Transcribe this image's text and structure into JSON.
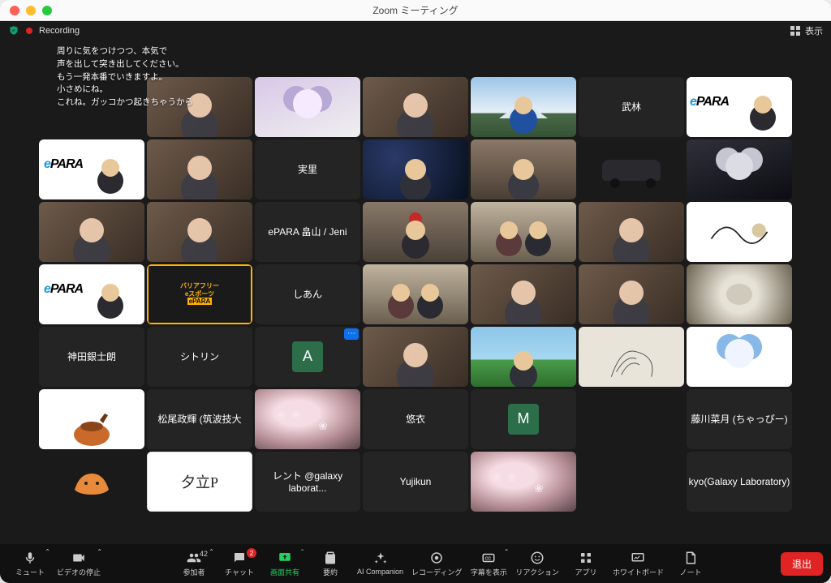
{
  "window": {
    "title": "Zoom ミーティング"
  },
  "topbar": {
    "recording_label": "Recording",
    "view_label": "表示"
  },
  "captions": [
    "周りに気をつけつつ、本気で",
    "声を出して突き出してください。",
    "もう一発本番でいきますよ。",
    "小さめにね。",
    "これね。ガッコかつ起きちゃうから"
  ],
  "tiles": {
    "r1": [
      "",
      "video",
      "anime",
      "video",
      "fuji",
      {
        "name": "武林"
      },
      "epara-glasses"
    ],
    "r2": [
      "epara-person",
      "speaker",
      {
        "name": "実里"
      },
      "space",
      "room",
      "car",
      "dark-anime"
    ],
    "r3": [
      "video",
      "video",
      {
        "name": "ePARA 畠山 / Jeni"
      },
      "santa",
      "two",
      "video",
      "white-draw"
    ],
    "r4": [
      "epara-person",
      "poster",
      {
        "name": "しあん"
      },
      "two",
      "video",
      "video",
      "bird"
    ],
    "r5": [
      {
        "name": "神田銀士朗"
      },
      {
        "name": "シトリン"
      },
      {
        "initial": "A",
        "hover": true
      },
      "video",
      "field",
      "sketch",
      "chibi"
    ],
    "r6": [
      "pot",
      {
        "name": "松尾政輝 (筑波技大"
      },
      "sakura",
      {
        "name": "悠衣"
      },
      {
        "initial": "M"
      },
      "",
      {
        "name": "藤川菜月 (ちゃっぴー)"
      }
    ],
    "r7": [
      "blob",
      "card",
      {
        "name": "レント @galaxy laborat..."
      },
      {
        "name": "Yujikun"
      },
      "sakura",
      "",
      {
        "name": "kyo(Galaxy Laboratory)"
      }
    ]
  },
  "card_text": "夕立P",
  "toolbar": {
    "mute": "ミュート",
    "stop_video": "ビデオの停止",
    "participants": "参加者",
    "participants_count": "42",
    "chat": "チャット",
    "chat_badge": "2",
    "share": "画面共有",
    "summary": "要約",
    "ai": "AI Companion",
    "record": "レコーディング",
    "captions": "字幕を表示",
    "reactions": "リアクション",
    "apps": "アプリ",
    "whiteboard": "ホワイトボード",
    "notes": "ノート",
    "leave": "退出"
  }
}
